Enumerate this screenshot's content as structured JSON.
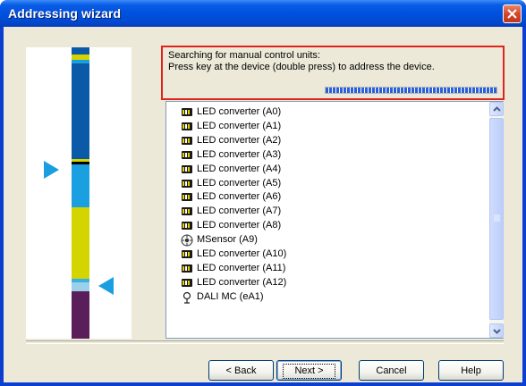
{
  "window": {
    "title": "Addressing wizard"
  },
  "status": {
    "line1": "Searching for manual control units:",
    "line2": "Press key at the device (double press) to address the device.",
    "progress": 1.0
  },
  "devices": [
    {
      "label": "LED converter (A0)",
      "icon": "led-converter-icon"
    },
    {
      "label": "LED converter (A1)",
      "icon": "led-converter-icon"
    },
    {
      "label": "LED converter (A2)",
      "icon": "led-converter-icon"
    },
    {
      "label": "LED converter (A3)",
      "icon": "led-converter-icon"
    },
    {
      "label": "LED converter (A4)",
      "icon": "led-converter-icon"
    },
    {
      "label": "LED converter (A5)",
      "icon": "led-converter-icon"
    },
    {
      "label": "LED converter (A6)",
      "icon": "led-converter-icon"
    },
    {
      "label": "LED converter (A7)",
      "icon": "led-converter-icon"
    },
    {
      "label": "LED converter (A8)",
      "icon": "led-converter-icon"
    },
    {
      "label": "MSensor (A9)",
      "icon": "sensor-icon"
    },
    {
      "label": "LED converter (A10)",
      "icon": "led-converter-icon"
    },
    {
      "label": "LED converter (A11)",
      "icon": "led-converter-icon"
    },
    {
      "label": "LED converter (A12)",
      "icon": "led-converter-icon"
    },
    {
      "label": "DALI MC (eA1)",
      "icon": "push-button-icon"
    }
  ],
  "buttons": {
    "back": "< Back",
    "next": "Next >",
    "cancel": "Cancel",
    "help": "Help"
  },
  "colors": {
    "highlight_border": "#e0241c",
    "bar_dark_blue": "#0a5aa8",
    "bar_light_blue": "#1aa0e0",
    "bar_yellow": "#d4d400",
    "bar_purple": "#5a1e5a",
    "marker_blue": "#1a9ee0"
  }
}
